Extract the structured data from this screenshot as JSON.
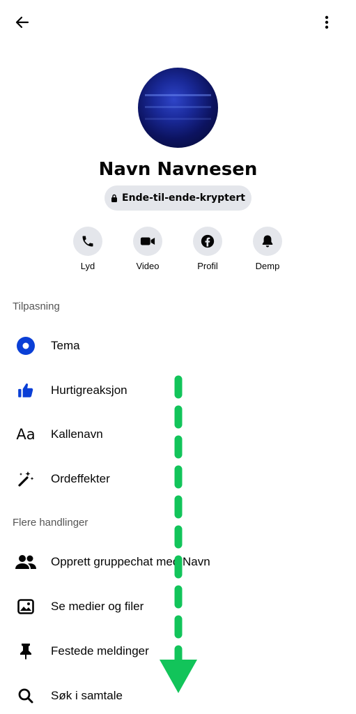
{
  "header": {
    "back_icon": "arrow-left-icon",
    "more_icon": "more-vertical-icon"
  },
  "profile": {
    "name": "Navn Navnesen",
    "encryption_badge": "Ende-til-ende-kryptert"
  },
  "actions": [
    {
      "label": "Lyd",
      "icon": "phone-icon"
    },
    {
      "label": "Video",
      "icon": "video-icon"
    },
    {
      "label": "Profil",
      "icon": "facebook-icon"
    },
    {
      "label": "Demp",
      "icon": "bell-icon"
    }
  ],
  "customization": {
    "title": "Tilpasning",
    "items": [
      {
        "label": "Tema",
        "icon": "theme-icon"
      },
      {
        "label": "Hurtigreaksjon",
        "icon": "thumbs-up-icon"
      },
      {
        "label": "Kallenavn",
        "icon": "text-aa-icon",
        "glyph": "Aa"
      },
      {
        "label": "Ordeffekter",
        "icon": "magic-wand-icon"
      }
    ]
  },
  "more_actions": {
    "title": "Flere handlinger",
    "items": [
      {
        "label": "Opprett gruppechat med Navn",
        "icon": "people-icon"
      },
      {
        "label": "Se medier og filer",
        "icon": "image-icon"
      },
      {
        "label": "Festede meldinger",
        "icon": "pin-icon"
      },
      {
        "label": "Søk i samtale",
        "icon": "search-icon"
      }
    ]
  },
  "colors": {
    "accent": "#0a3fd6",
    "arrow": "#12c45a",
    "chip": "#e4e6eb"
  }
}
